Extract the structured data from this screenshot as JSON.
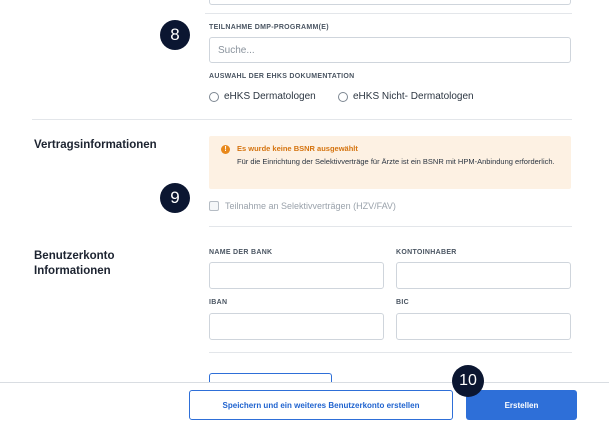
{
  "badges": {
    "b8": "8",
    "b9": "9",
    "b10": "10"
  },
  "dmp": {
    "label": "TEILNAHME DMP-PROGRAMM(E)",
    "placeholder": "Suche..."
  },
  "ehks": {
    "label": "AUSWAHL DER EHKS DOKUMENTATION",
    "options": [
      "eHKS Dermatologen",
      "eHKS Nicht- Dermatologen"
    ]
  },
  "contract": {
    "title": "Vertragsinformationen",
    "warning_title": "Es wurde keine BSNR ausgewählt",
    "warning_text": "Für die Einrichtung der Selektivverträge für Ärzte ist ein BSNR mit HPM-Anbindung erforderlich.",
    "checkbox_label": "Teilnahme an Selektivverträgen (HZV/FAV)"
  },
  "account": {
    "title_line1": "Benutzerkonto",
    "title_line2": "Informationen",
    "bank_name_label": "NAME DER BANK",
    "account_holder_label": "KONTOINHABER",
    "iban_label": "IBAN",
    "bic_label": "BIC"
  },
  "footer": {
    "save_and_new": "Speichern und ein weiteres Benutzerkonto erstellen",
    "create": "Erstellen"
  },
  "colors": {
    "primary": "#2e6fd8",
    "warning": "#e8891c",
    "badge": "#0b1631"
  }
}
